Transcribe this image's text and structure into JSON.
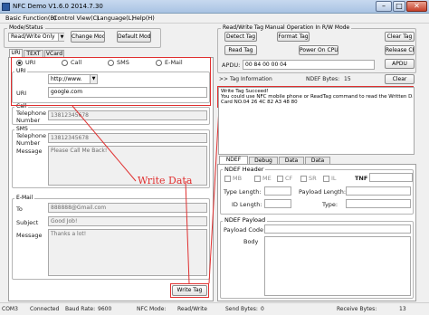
{
  "window": {
    "title": "NFC Demo V1.6.0 2014.7.30"
  },
  "menu": [
    "Basic Function(B)",
    "Control View(C)",
    "Language(L)",
    "Help(H)"
  ],
  "mode": {
    "group_title": "Mode/Status",
    "selected_mode": "Read/Write Only",
    "change_button": "Change Mode",
    "default_button": "Default Mode"
  },
  "write_tabs": [
    "URI",
    "TEXT",
    "VCard"
  ],
  "record_type": {
    "options": [
      "URI",
      "Call",
      "SMS",
      "E-Mail"
    ],
    "selected": "URI"
  },
  "uri": {
    "section_label": "URI",
    "prefix": "http://www.",
    "label": "URI",
    "value": "google.com"
  },
  "call": {
    "section_label": "Call",
    "number_label": "Telephone Number",
    "number_value": "13812345678"
  },
  "sms": {
    "section_label": "SMS",
    "number_label": "Telephone Number",
    "number_value": "13812345678",
    "message_label": "Message",
    "message_value": "Please Call Me Back!"
  },
  "email": {
    "section_label": "E-Mail",
    "to_label": "To",
    "to_value": "888888@Gmail.com",
    "subject_label": "Subject",
    "subject_value": "Good Job!",
    "message_label": "Message",
    "message_value": "Thanks a lot!"
  },
  "annotation_text": "Write Data",
  "write_tag_button": "Write Tag",
  "manual_op": {
    "group_title": "Read/Write Tag Manual Operation In R/W Mode",
    "row1": [
      "Detect Tag",
      "Format Tag",
      "Clear Tag"
    ],
    "row2": [
      "Read Tag",
      "Power On CPU",
      "Release CPU"
    ],
    "apdu_label": "APDU:",
    "apdu_value": "00 84 00 00 04",
    "apdu_button": "APDU"
  },
  "tag_info": {
    "label": ">> Tag Information",
    "ndef_bytes_label": "NDEF Bytes:",
    "ndef_bytes_value": "15",
    "clear_button": "Clear",
    "log": [
      "Write Tag Succeed!",
      "You could use NFC mobile phone or ReadTag command to read the Written Data:",
      "Card NO.04 26 4C 82 A3 48 80"
    ]
  },
  "detail_tabs": [
    "NDEF Detail",
    "Debug Info",
    "Data Hex",
    "Data UTF"
  ],
  "ndef_header": {
    "title": "NDEF Header",
    "flags": [
      "MB",
      "ME",
      "CF",
      "SR",
      "IL"
    ],
    "tnf_label": "TNF",
    "type_length_label": "Type Length:",
    "payload_length_label": "Payload Length:",
    "id_length_label": "ID Length:",
    "type_label": "Type:"
  },
  "ndef_payload": {
    "title": "NDEF Payload",
    "payload_code_label": "Payload Code",
    "body_label": "Body"
  },
  "status": {
    "com_label": "COM3",
    "com_state": "Connected",
    "baud_label": "Baud Rate:",
    "baud_value": "9600",
    "mode_label": "NFC Mode:",
    "mode_value": "Read/Write",
    "send_label": "Send Bytes:",
    "send_value": "0",
    "recv_label": "Receive Bytes:",
    "recv_value": "13"
  },
  "colors": {
    "annotation_red": "#e03030",
    "titlebar_blue": "#a9c3e3",
    "selection_blue": "#1e5ccc"
  }
}
